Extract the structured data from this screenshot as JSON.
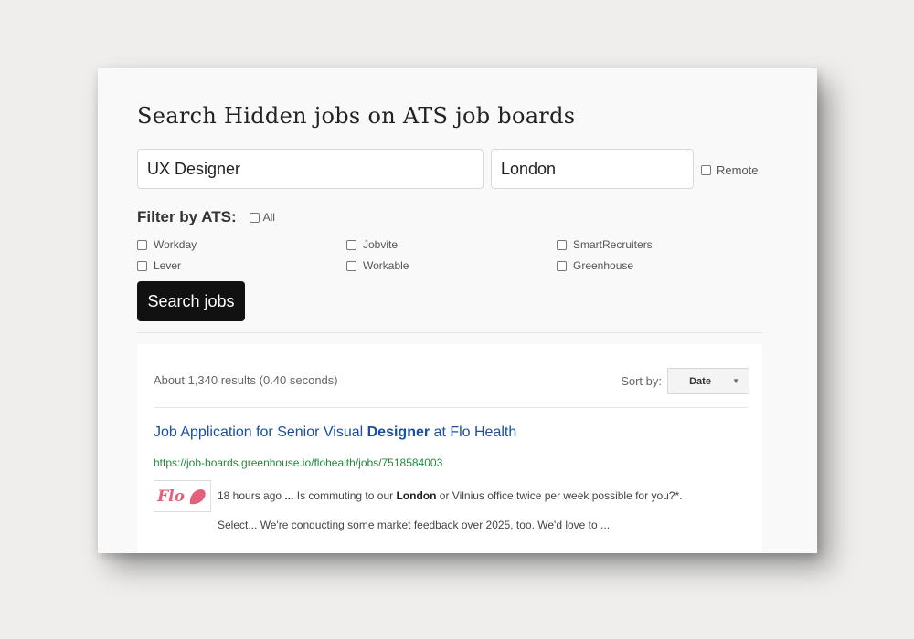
{
  "page": {
    "title": "Search Hidden jobs on ATS job boards"
  },
  "search": {
    "keyword_value": "UX Designer",
    "location_value": "London",
    "remote_label": "Remote",
    "button_label": "Search jobs"
  },
  "filter": {
    "title": "Filter by ATS:",
    "all_label": "All",
    "options": [
      {
        "label": "Workday",
        "checked": false
      },
      {
        "label": "Lever",
        "checked": false
      },
      {
        "label": "Jobvite",
        "checked": false
      },
      {
        "label": "Workable",
        "checked": false
      },
      {
        "label": "SmartRecruiters",
        "checked": false
      },
      {
        "label": "Greenhouse",
        "checked": false
      }
    ]
  },
  "results": {
    "stats": "About 1,340 results (0.40 seconds)",
    "sort_label": "Sort by:",
    "sort_value": "Date",
    "items": [
      {
        "title_pre": "Job Application for Senior Visual ",
        "title_bold": "Designer",
        "title_post": " at Flo Health",
        "url": "https://job-boards.greenhouse.io/flohealth/jobs/7518584003",
        "logo_text": "Flo",
        "logo_icon": "petal-icon",
        "snippet_time": "18 hours ago ",
        "snippet_ellipsis": "...",
        "snippet_a": " Is commuting to our ",
        "snippet_bold": "London",
        "snippet_b": " or Vilnius office twice per week possible for you?*.",
        "snippet_line2": "Select... We're conducting some market feedback over 2025, too. We'd love to ..."
      }
    ]
  },
  "colors": {
    "link": "#1a4fa0",
    "url": "#1e8a3c",
    "logo": "#e4607b",
    "button_bg": "#111111"
  }
}
